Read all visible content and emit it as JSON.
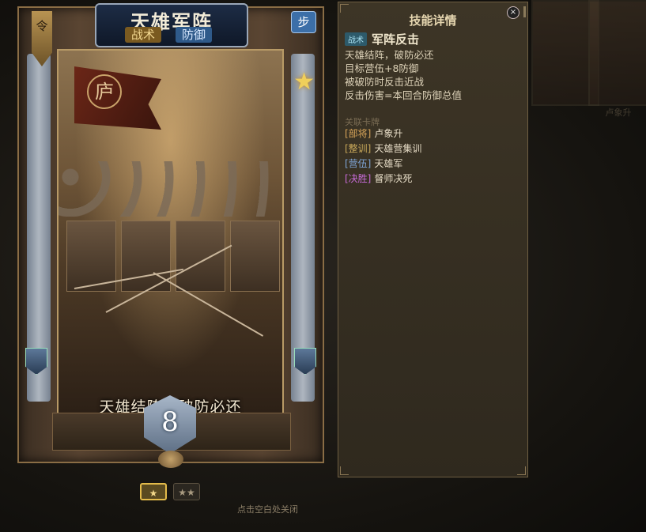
{
  "card": {
    "title": "天雄军阵",
    "tag_tactic": "战术",
    "tag_defense": "防御",
    "ling_char": "令",
    "type_badge": "步",
    "banner_char": "庐",
    "caption": "天雄结阵，破防必还",
    "cost": "8"
  },
  "star_levels": {
    "one": "★",
    "two": "★★"
  },
  "hint": "点击空白处关闭",
  "panel": {
    "title": "技能详情",
    "close_icon": "×",
    "skill_tag": "战术",
    "skill_name": "军阵反击",
    "desc_lines": [
      "天雄结阵，破防必还",
      "目标营伍+8防御",
      "被破防时反击近战",
      "反击伤害=本回合防御总值"
    ],
    "related_title": "关联卡牌",
    "related": [
      {
        "category": "[部将]",
        "name": "卢象升",
        "color": "#d9a65a"
      },
      {
        "category": "[整训]",
        "name": "天雄营集训",
        "color": "#c9a95a"
      },
      {
        "category": "[营伍]",
        "name": "天雄军",
        "color": "#7fa6d8"
      },
      {
        "category": "[决胜]",
        "name": "督师决死",
        "color": "#c86bd8"
      }
    ]
  },
  "background": {
    "right_caption": "卢象升"
  }
}
